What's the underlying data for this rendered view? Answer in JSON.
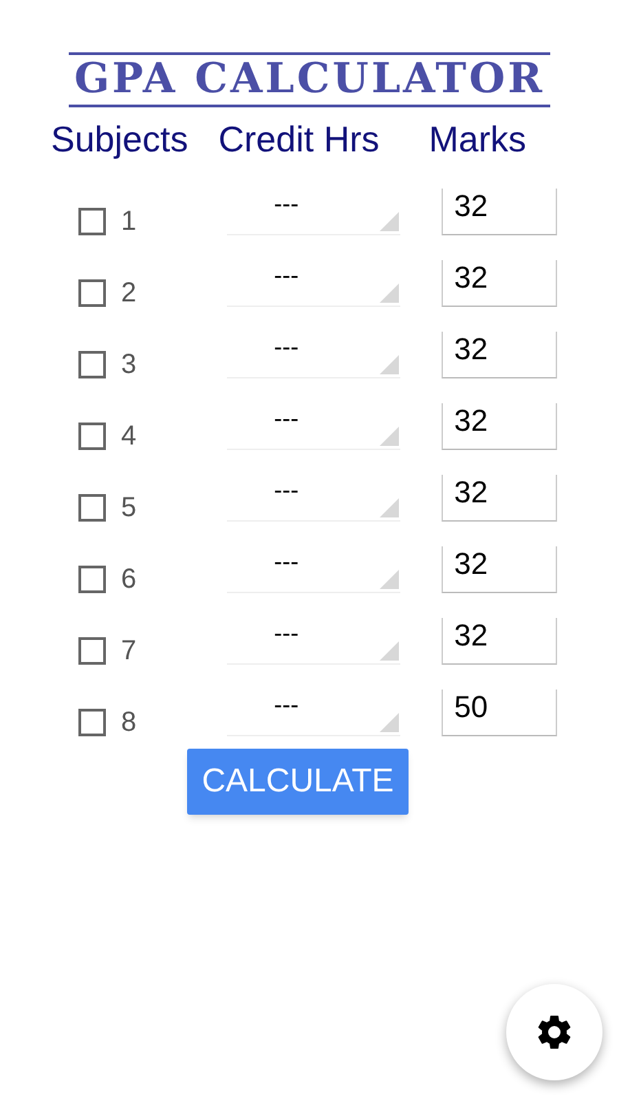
{
  "title": "GPA CALCULATOR",
  "headers": [
    "Subjects",
    "Credit Hrs",
    "Marks"
  ],
  "subjects": [
    {
      "label": "1",
      "checked": false,
      "credit": "---",
      "marks": "32"
    },
    {
      "label": "2",
      "checked": false,
      "credit": "---",
      "marks": "32"
    },
    {
      "label": "3",
      "checked": false,
      "credit": "---",
      "marks": "32"
    },
    {
      "label": "4",
      "checked": false,
      "credit": "---",
      "marks": "32"
    },
    {
      "label": "5",
      "checked": false,
      "credit": "---",
      "marks": "32"
    },
    {
      "label": "6",
      "checked": false,
      "credit": "---",
      "marks": "32"
    },
    {
      "label": "7",
      "checked": false,
      "credit": "---",
      "marks": "32"
    },
    {
      "label": "8",
      "checked": false,
      "credit": "---",
      "marks": "50"
    }
  ],
  "calculate_button": "CALCULATE"
}
